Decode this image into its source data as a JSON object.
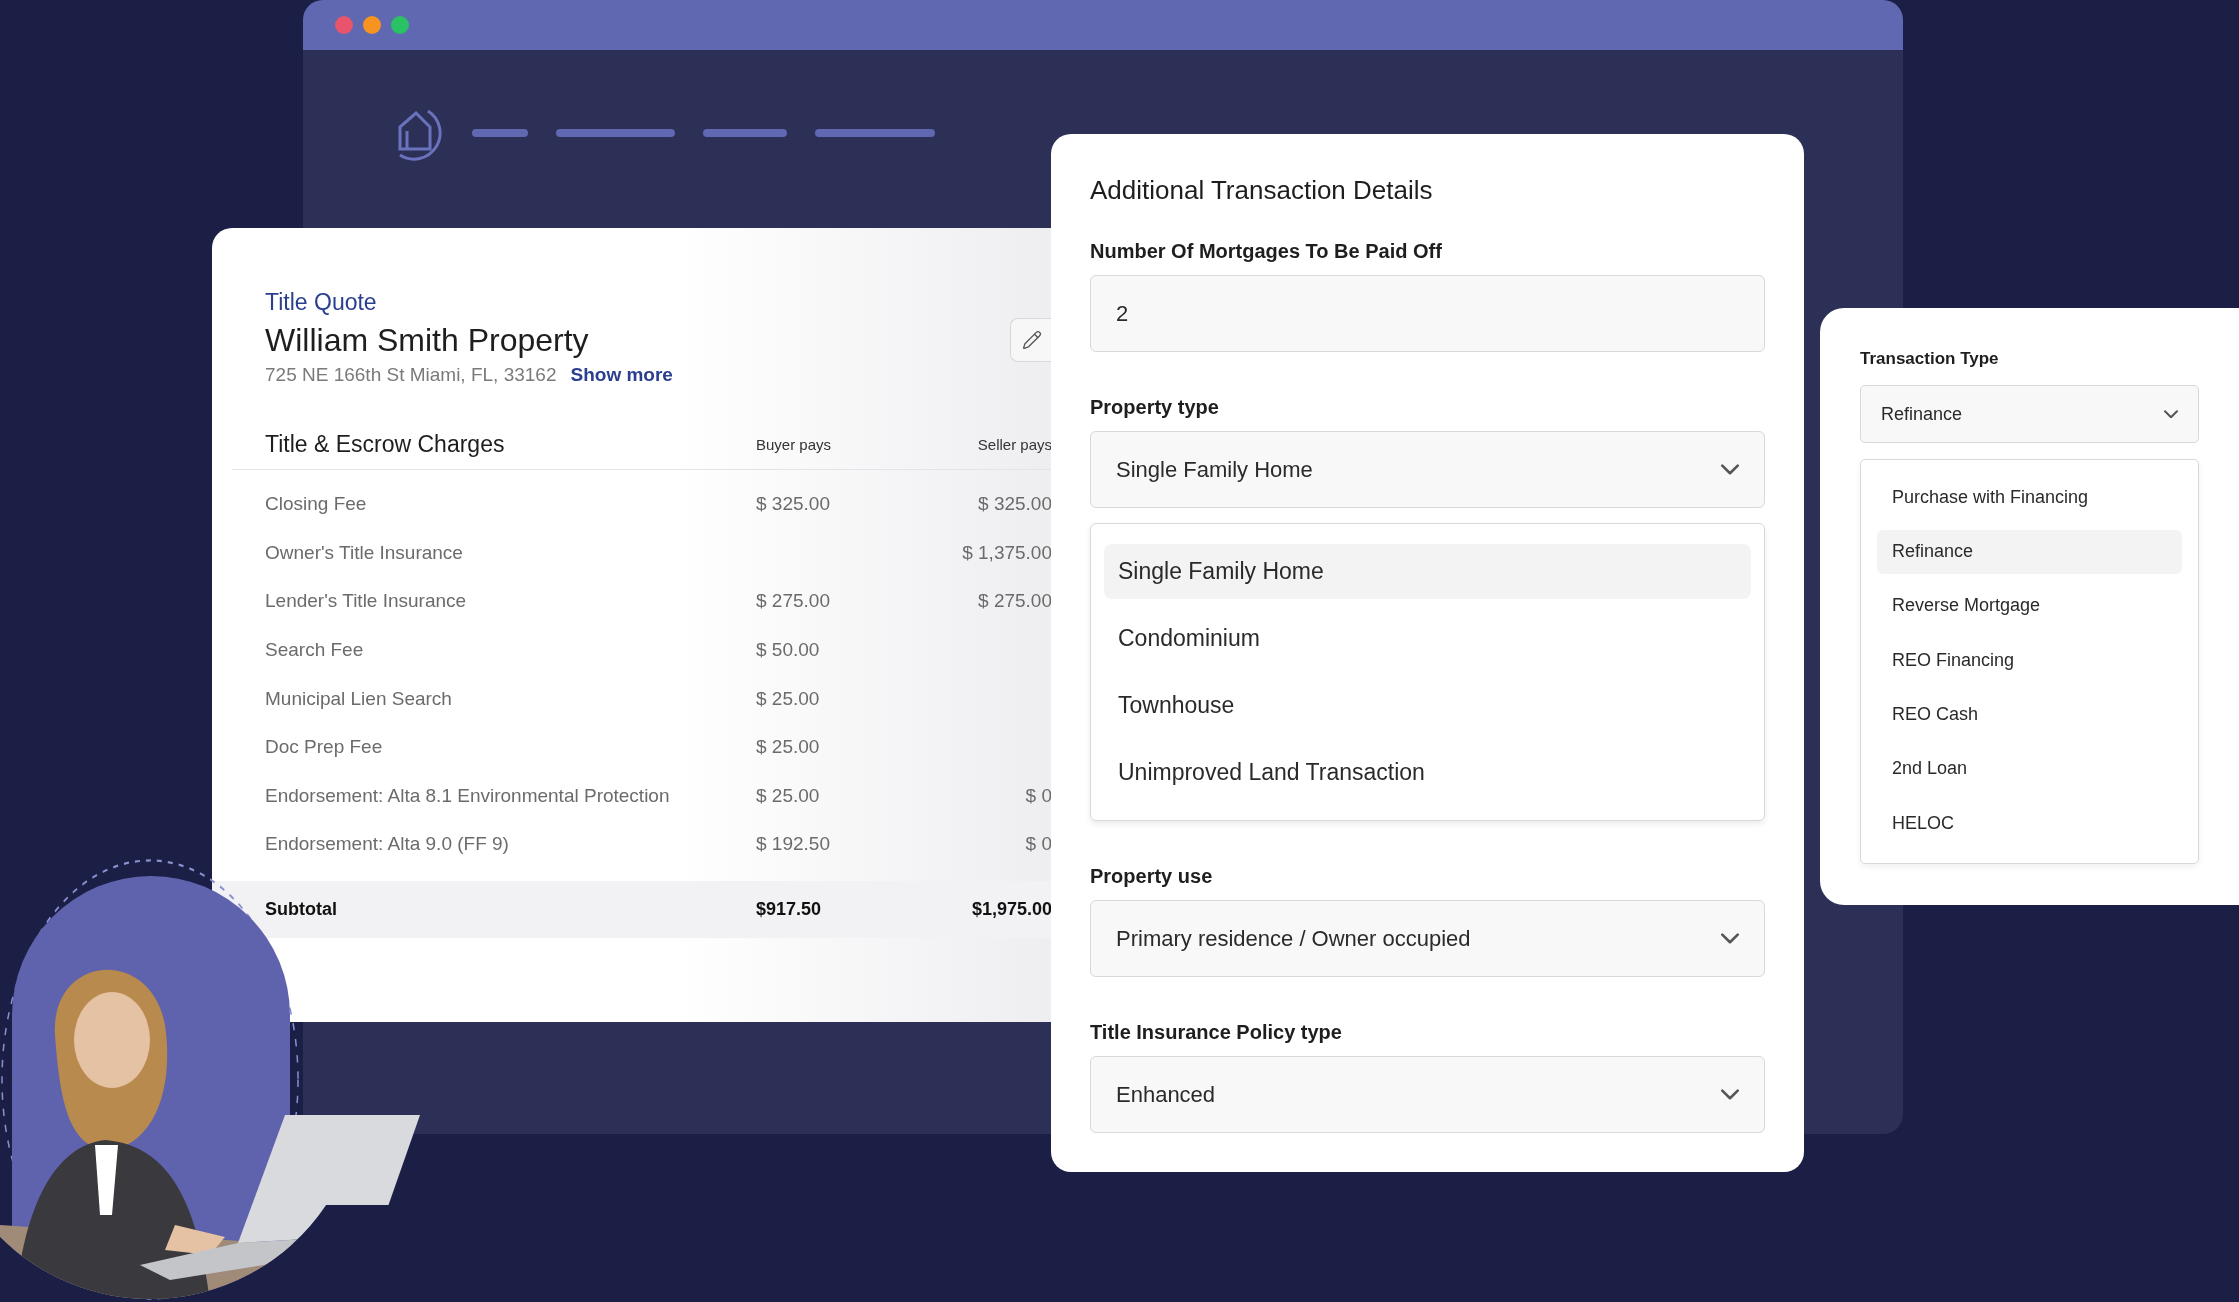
{
  "quote": {
    "eyebrow": "Title Quote",
    "title": "William Smith Property",
    "address": "725 NE 166th St Miami, FL, 33162",
    "show_more": "Show more",
    "table": {
      "title": "Title & Escrow Charges",
      "columns": [
        "Buyer pays",
        "Seller pays"
      ],
      "rows": [
        {
          "label": "Closing Fee",
          "buyer": "$ 325.00",
          "seller": "$ 325.00"
        },
        {
          "label": "Owner's Title Insurance",
          "seller": "$ 1,375.00"
        },
        {
          "label": "Lender's Title Insurance",
          "buyer": "$ 275.00",
          "seller": "$ 275.00"
        },
        {
          "label": "Search Fee",
          "buyer": "$ 50.00"
        },
        {
          "label": "Municipal Lien Search",
          "buyer": "$ 25.00"
        },
        {
          "label": "Doc Prep Fee",
          "buyer": "$ 25.00"
        },
        {
          "label": "Endorsement: Alta 8.1 Environmental Protection",
          "buyer": "$ 25.00",
          "seller": "$ 0"
        },
        {
          "label": "Endorsement: Alta 9.0 (FF 9)",
          "buyer": "$ 192.50",
          "seller": "$ 0"
        }
      ],
      "subtotal": {
        "label": "Subtotal",
        "buyer": "$917.50",
        "seller": "$1,975.00"
      }
    }
  },
  "details": {
    "title": "Additional Transaction Details",
    "fields": [
      {
        "kind": "input",
        "label": "Number Of Mortgages To Be Paid Off",
        "value": "2"
      },
      {
        "kind": "select",
        "label": "Property type",
        "value": "Single Family Home",
        "expanded": true,
        "options": [
          {
            "label": "Single Family Home",
            "selected": true
          },
          {
            "label": "Condominium",
            "selected": false
          },
          {
            "label": "Townhouse",
            "selected": false
          },
          {
            "label": "Unimproved Land Transaction",
            "selected": false
          }
        ]
      },
      {
        "kind": "select",
        "label": "Property use",
        "value": "Primary residence / Owner occupied"
      },
      {
        "kind": "select",
        "label": "Title Insurance Policy type",
        "value": "Enhanced"
      }
    ]
  },
  "transaction": {
    "label": "Transaction Type",
    "value": "Refinance",
    "expanded": true,
    "options": [
      {
        "label": "Purchase with Financing",
        "selected": false
      },
      {
        "label": "Refinance",
        "selected": true
      },
      {
        "label": "Reverse Mortgage",
        "selected": false
      },
      {
        "label": "REO Financing",
        "selected": false
      },
      {
        "label": "REO Cash",
        "selected": false
      },
      {
        "label": "2nd Loan",
        "selected": false
      },
      {
        "label": "HELOC",
        "selected": false
      }
    ]
  }
}
